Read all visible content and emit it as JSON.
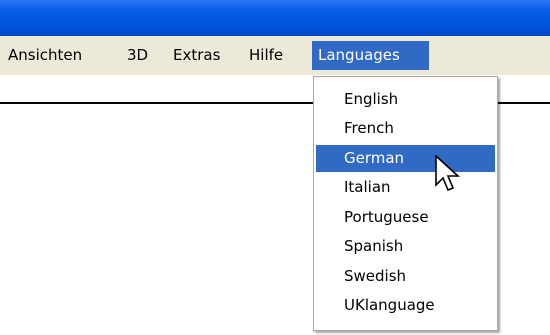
{
  "menubar": {
    "items": [
      {
        "label": "Ansichten"
      },
      {
        "label": "3D"
      },
      {
        "label": "Extras"
      },
      {
        "label": "Hilfe"
      },
      {
        "label": "Languages",
        "active": true
      }
    ]
  },
  "languages_menu": {
    "items": [
      {
        "label": "English"
      },
      {
        "label": "French"
      },
      {
        "label": "German",
        "highlighted": true
      },
      {
        "label": "Italian"
      },
      {
        "label": "Portuguese"
      },
      {
        "label": "Spanish"
      },
      {
        "label": "Swedish"
      },
      {
        "label": "UKlanguage"
      }
    ]
  },
  "colors": {
    "titlebar": "#0054e3",
    "menubar": "#ece9d8",
    "highlight": "#316ac5"
  },
  "icons": {
    "cursor": "arrow-cursor-icon"
  }
}
